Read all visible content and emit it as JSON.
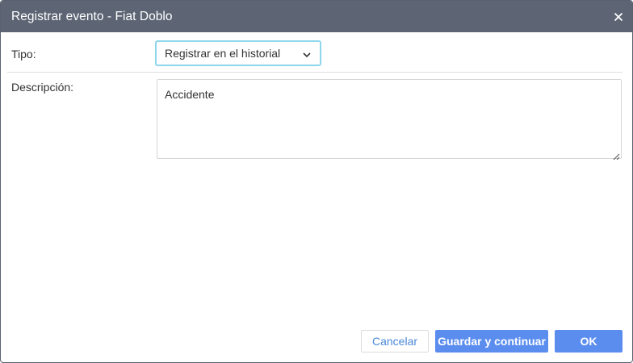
{
  "dialog": {
    "title": "Registrar evento - Fiat Doblo",
    "close_icon": "close-icon"
  },
  "form": {
    "tipo_label": "Tipo:",
    "tipo_value": "Registrar en el historial",
    "descripcion_label": "Descripción:",
    "descripcion_value": "Accidente"
  },
  "footer": {
    "cancel_label": "Cancelar",
    "save_continue_label": "Guardar y continuar",
    "ok_label": "OK"
  },
  "colors": {
    "titlebar": "#5d6575",
    "primary": "#5b8def",
    "link": "#4a88d8",
    "focus": "#8ed6ec"
  }
}
